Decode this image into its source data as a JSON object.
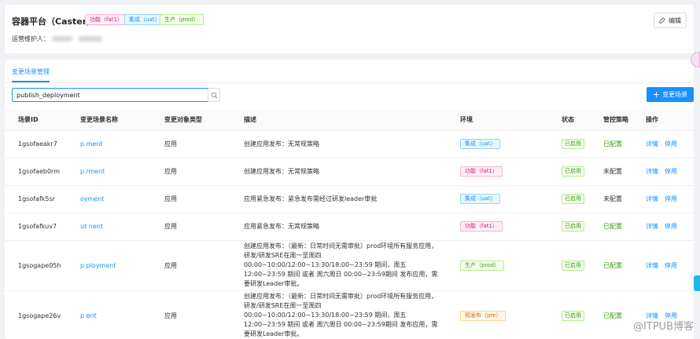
{
  "header": {
    "title": "容器平台（Caster）",
    "tags": [
      "功能（fat1）",
      "集成（uat）",
      "生产（prod）"
    ],
    "maintainer_label": "运营维护人：",
    "edit_label": "编辑"
  },
  "tabs": {
    "active": "变更场景管理"
  },
  "search": {
    "value": "publish_deployment"
  },
  "toolbar": {
    "add_label": "变更场景"
  },
  "table": {
    "columns": [
      "场景ID",
      "变更场景名称",
      "变更对象类型",
      "描述",
      "环境",
      "状态",
      "管控策略",
      "操作"
    ],
    "rows": [
      {
        "id": "1gsofaeakr7",
        "name": "p          ment",
        "type": "应用",
        "desc": "创建应用发布：无常规策略",
        "env": "集成（uat）",
        "env_kind": "uat",
        "status": "已启用",
        "policy": "已配置",
        "policy_kind": "on",
        "actions": [
          "详情",
          "停用"
        ]
      },
      {
        "id": "1gsofaeb0rm",
        "name": "p          /ment",
        "type": "应用",
        "desc": "创建应用发布：无常规策略",
        "env": "功能（fat1）",
        "env_kind": "fat",
        "status": "已启用",
        "policy": "未配置",
        "policy_kind": "off",
        "actions": [
          "详情",
          "停用"
        ]
      },
      {
        "id": "1gsofafk5sr",
        "name": "           oyment",
        "type": "应用",
        "desc": "应用紧急发布：紧急发布需经过研发leader审批",
        "env": "集成（uat）",
        "env_kind": "uat",
        "status": "已启用",
        "policy": "未配置",
        "policy_kind": "off",
        "actions": [
          "详情",
          "停用"
        ]
      },
      {
        "id": "1gsofafkuv7",
        "name": "ut              nent",
        "type": "应用",
        "desc": "应用紧急发布：无常规策略",
        "env": "功能（fat1）",
        "env_kind": "fat",
        "status": "已启用",
        "policy": "已配置",
        "policy_kind": "on",
        "actions": [
          "详情",
          "停用"
        ]
      },
      {
        "id": "1gsogape05h",
        "name": "p          ployment",
        "type": "应用",
        "desc": "创建应用发布：（最新：日常时间无需审批）prod环境所有服务应用，研发/研发SRE在周一至周四 00:00~10:00/12:00~13:30/18:00~23:59 期间，周五 12:00~23:59 期间 或者 周六周日 00:00~23:59期间 发布应用，需要研发Leader审批。",
        "env": "生产（prod）",
        "env_kind": "prod",
        "status": "已启用",
        "policy": "已配置",
        "policy_kind": "on",
        "actions": [
          "详情",
          "停用"
        ]
      },
      {
        "id": "1gsogape26v",
        "name": "p          ent",
        "type": "应用",
        "desc": "创建应用发布：（最新：日常时间无需审批）prod环境所有服务应用，研发/研发SRE在周一至周四 00:00~10:00/12:00~13:30/18:00~23:59 期间，周五 12:00~23:59 期间 或者 周六周日 00:00~23:59期间 发布应用，需要研发Leader审批。",
        "env": "预发布（pre）",
        "env_kind": "pre",
        "status": "已启用",
        "policy": "已配置",
        "policy_kind": "on",
        "actions": [
          "详情",
          "停用"
        ]
      }
    ]
  },
  "watermark": "@ITPUB博客"
}
